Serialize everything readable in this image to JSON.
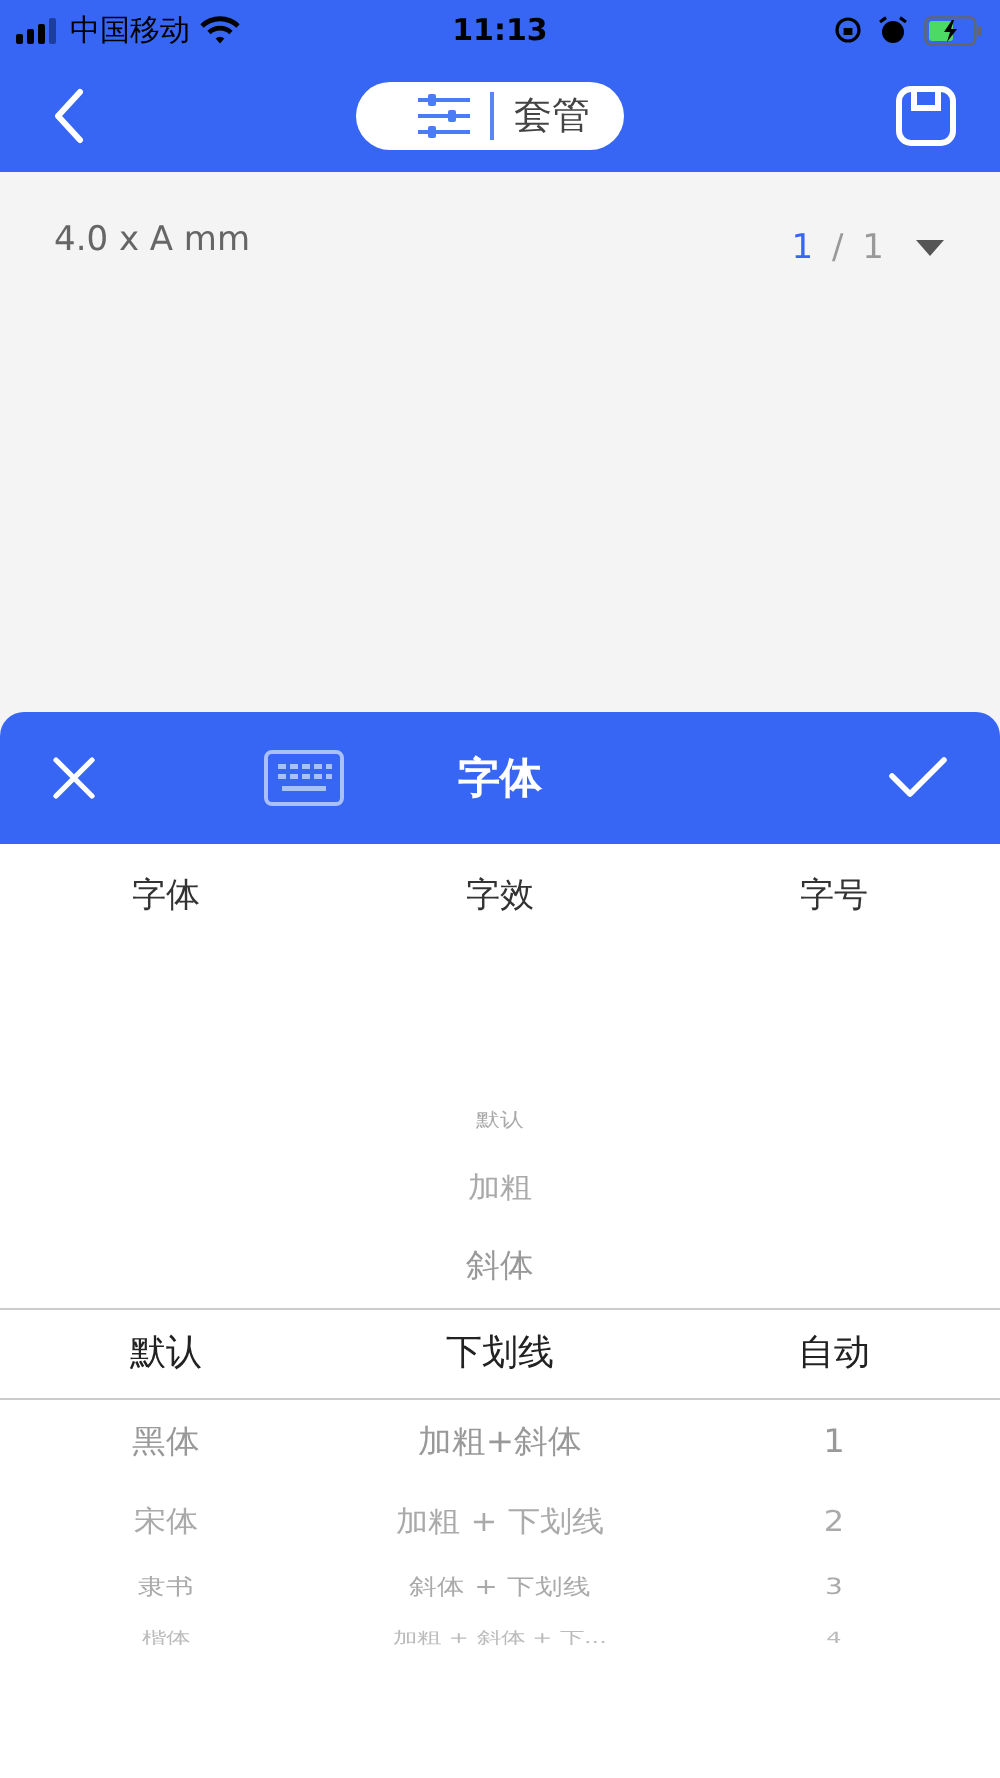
{
  "status_bar": {
    "carrier": "中国移动",
    "time": "11:13"
  },
  "nav": {
    "tab_label": "套管"
  },
  "label": {
    "size": "4.0 x A mm",
    "page_current": "1",
    "page_separator": "/",
    "page_total": "1"
  },
  "sheet": {
    "title": "字体"
  },
  "pickers": [
    {
      "header": "字体",
      "items": [
        {
          "text": "默认",
          "selected": true
        },
        {
          "text": "黑体",
          "selected": false
        },
        {
          "text": "宋体",
          "selected": false
        },
        {
          "text": "隶书",
          "selected": false
        },
        {
          "text": "楷体",
          "selected": false
        }
      ]
    },
    {
      "header": "字效",
      "items": [
        {
          "text": "默认",
          "selected": false
        },
        {
          "text": "加粗",
          "selected": false
        },
        {
          "text": "斜体",
          "selected": false
        },
        {
          "text": "下划线",
          "selected": true
        },
        {
          "text": "加粗+斜体",
          "selected": false
        },
        {
          "text": "加粗 + 下划线",
          "selected": false
        },
        {
          "text": "斜体 + 下划线",
          "selected": false
        },
        {
          "text": "加粗 + 斜体 + 下...",
          "selected": false
        }
      ]
    },
    {
      "header": "字号",
      "items": [
        {
          "text": "自动",
          "selected": true
        },
        {
          "text": "1",
          "selected": false
        },
        {
          "text": "2",
          "selected": false
        },
        {
          "text": "3",
          "selected": false
        },
        {
          "text": "4",
          "selected": false
        }
      ]
    }
  ]
}
